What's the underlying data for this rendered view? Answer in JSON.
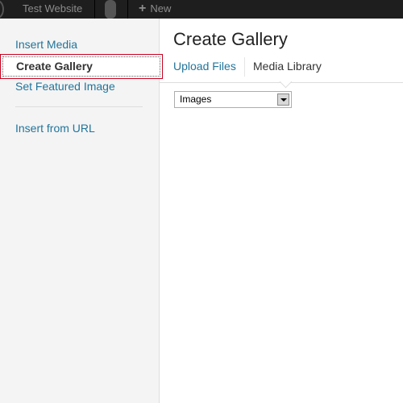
{
  "admin_bar": {
    "site_name": "Test Website",
    "new_label": "New",
    "new_icon": "plus-icon",
    "comments_icon": "comment-bubble-icon",
    "logo_icon": "wordpress-logo-icon"
  },
  "sidebar": {
    "items": [
      {
        "label": "Insert Media",
        "active": false
      },
      {
        "label": "Create Gallery",
        "active": true
      },
      {
        "label": "Set Featured Image",
        "active": false
      },
      {
        "label": "Insert from URL",
        "active": false
      }
    ]
  },
  "content": {
    "title": "Create Gallery",
    "tabs": [
      {
        "label": "Upload Files",
        "active": false
      },
      {
        "label": "Media Library",
        "active": true
      }
    ],
    "filter": {
      "selected": "Images"
    }
  },
  "colors": {
    "link": "#21759b",
    "active_outline": "#c6001e",
    "admin_bar": "#1e1e1e"
  }
}
